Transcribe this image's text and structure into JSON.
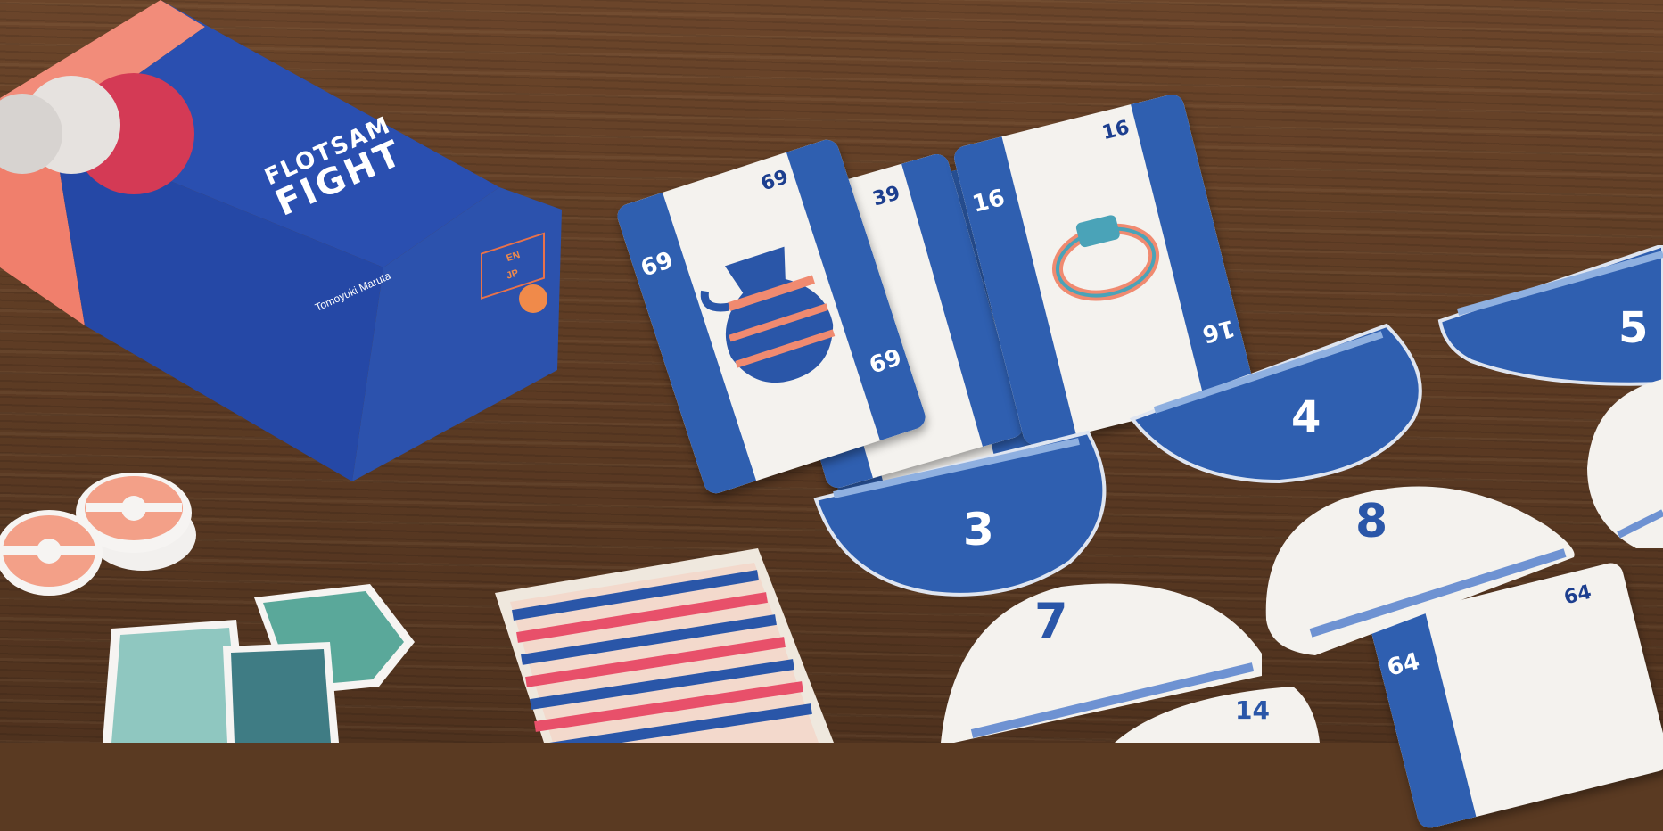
{
  "scene": {
    "box_title_line1": "FLOTSAM",
    "box_title_line2": "FIGHT",
    "box_author": "Tomoyuki Maruta",
    "box_side_lang1": "EN",
    "box_side_lang2": "JP"
  },
  "cards": {
    "vase_card_value": "69",
    "back_card_value": "39",
    "ring_card_value": "16",
    "corner_card_value": "64"
  },
  "tiles": {
    "tile_3": "3",
    "tile_4": "4",
    "tile_5": "5",
    "tile_7": "7",
    "tile_8": "8",
    "tile_14": "14"
  },
  "colors": {
    "blue": "#2a56a8",
    "coral": "#f08a78",
    "white": "#f4f2ee"
  }
}
